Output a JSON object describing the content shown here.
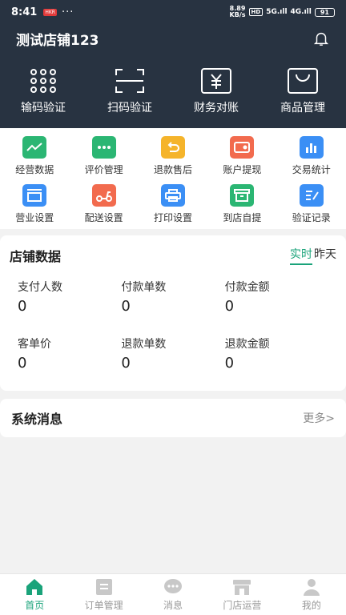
{
  "status": {
    "time": "8:41",
    "badge": "HKR",
    "dots": "···",
    "speed_top": "8.89",
    "speed_bottom": "KB/s",
    "hd": "HD",
    "sig1": "5G.ıll",
    "sig2": "4G.ıll",
    "battery": "91"
  },
  "header": {
    "shop_name": "测试店铺123"
  },
  "top_actions": [
    {
      "label": "输码验证",
      "icon": "keypad-icon"
    },
    {
      "label": "扫码验证",
      "icon": "scan-icon"
    },
    {
      "label": "财务对账",
      "icon": "finance-icon"
    },
    {
      "label": "商品管理",
      "icon": "bag-icon"
    }
  ],
  "grid": [
    {
      "label": "经营数据",
      "icon": "chart-icon",
      "color": "#2bb673"
    },
    {
      "label": "评价管理",
      "icon": "comment-icon",
      "color": "#2bb673"
    },
    {
      "label": "退款售后",
      "icon": "refund-icon",
      "color": "#f5b42b"
    },
    {
      "label": "账户提现",
      "icon": "wallet-icon",
      "color": "#f26b4e"
    },
    {
      "label": "交易统计",
      "icon": "bar-stats-icon",
      "color": "#3b8ff5"
    },
    {
      "label": "营业设置",
      "icon": "store-icon",
      "color": "#3b8ff5"
    },
    {
      "label": "配送设置",
      "icon": "scooter-icon",
      "color": "#f26b4e"
    },
    {
      "label": "打印设置",
      "icon": "printer-icon",
      "color": "#3b8ff5"
    },
    {
      "label": "到店自提",
      "icon": "box-icon",
      "color": "#2bb673"
    },
    {
      "label": "验证记录",
      "icon": "record-icon",
      "color": "#3b8ff5"
    }
  ],
  "store_data": {
    "title": "店铺数据",
    "toggle_on": "实时",
    "toggle_off": "昨天",
    "stats": [
      {
        "label": "支付人数",
        "value": "0"
      },
      {
        "label": "付款单数",
        "value": "0"
      },
      {
        "label": "付款金额",
        "value": "0"
      },
      {
        "label": "客单价",
        "value": "0"
      },
      {
        "label": "退款单数",
        "value": "0"
      },
      {
        "label": "退款金额",
        "value": "0"
      }
    ]
  },
  "messages": {
    "title": "系统消息",
    "more": "更多>"
  },
  "tabs": [
    {
      "label": "首页",
      "icon": "home-icon"
    },
    {
      "label": "订单管理",
      "icon": "orders-icon"
    },
    {
      "label": "消息",
      "icon": "message-icon"
    },
    {
      "label": "门店运营",
      "icon": "shop-icon"
    },
    {
      "label": "我的",
      "icon": "profile-icon"
    }
  ],
  "colors": {
    "header_bg": "#283341",
    "accent": "#1aa37a"
  }
}
